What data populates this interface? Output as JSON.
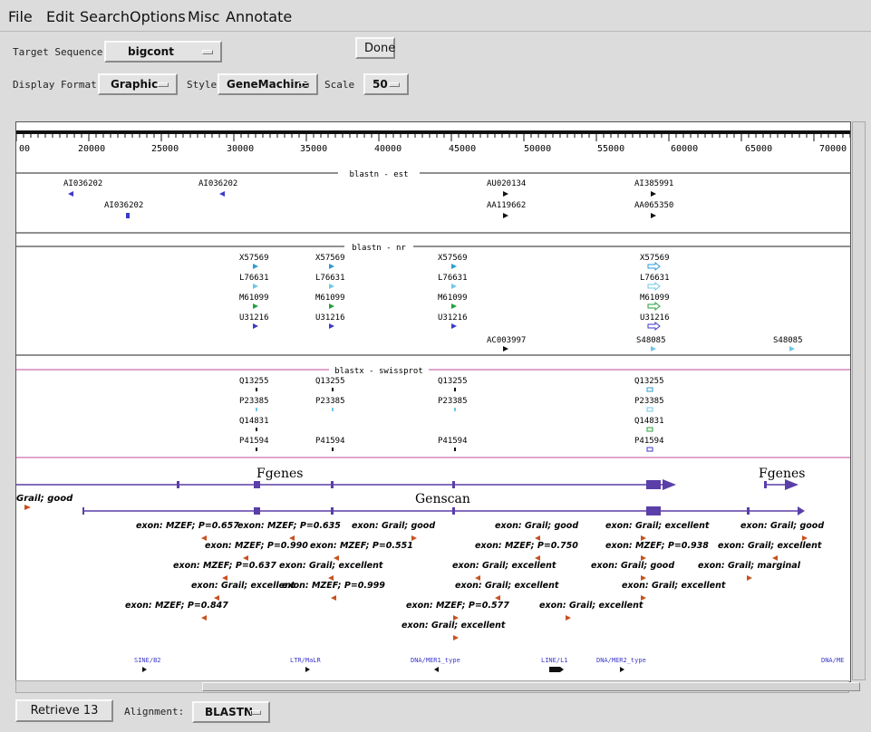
{
  "menu": {
    "items": [
      {
        "label": "File",
        "name": "menu-file"
      },
      {
        "label": "Edit",
        "name": "menu-edit"
      },
      {
        "label": "Search",
        "name": "menu-search"
      },
      {
        "label": "Options",
        "name": "menu-options"
      },
      {
        "label": "Misc",
        "name": "menu-misc"
      },
      {
        "label": "Annotate",
        "name": "menu-annotate"
      }
    ]
  },
  "controls": {
    "target_label": "Target Sequence",
    "target_value": "bigcont",
    "done_label": "Done",
    "display_format_label": "Display Format",
    "display_format_value": "Graphic",
    "style_label": "Style",
    "style_value": "GeneMachine",
    "scale_label": "Scale",
    "scale_value": "50"
  },
  "ruler": {
    "labels": [
      "00",
      "20000",
      "25000",
      "30000",
      "35000",
      "40000",
      "45000",
      "50000",
      "55000",
      "60000",
      "65000",
      "70000"
    ]
  },
  "tracks": {
    "est": {
      "title": "blastn - est",
      "hits": [
        {
          "id": "AI036202",
          "glyph": "left",
          "color": "#3b39c9"
        },
        {
          "id": "AI036202",
          "glyph": "left",
          "color": "#3b39c9"
        },
        {
          "id": "AI036202",
          "glyph": "block",
          "color": "#3b39c9"
        },
        {
          "id": "AU020134",
          "glyph": "right",
          "color": "#111111"
        },
        {
          "id": "AA119662",
          "glyph": "right",
          "color": "#111111"
        },
        {
          "id": "AI385991",
          "glyph": "right",
          "color": "#111111"
        },
        {
          "id": "AA065350",
          "glyph": "right",
          "color": "#111111"
        }
      ]
    },
    "nr": {
      "title": "blastn - nr",
      "hits": [
        {
          "id": "X57569",
          "glyph": "right",
          "color": "#2a9bd4"
        },
        {
          "id": "X57569",
          "glyph": "right",
          "color": "#2a9bd4"
        },
        {
          "id": "X57569",
          "glyph": "right",
          "color": "#2a9bd4"
        },
        {
          "id": "X57569",
          "glyph": "hollow",
          "color": "#2a9bd4"
        },
        {
          "id": "L76631",
          "glyph": "right",
          "color": "#6fc7e8"
        },
        {
          "id": "L76631",
          "glyph": "right",
          "color": "#6fc7e8"
        },
        {
          "id": "L76631",
          "glyph": "right",
          "color": "#6fc7e8"
        },
        {
          "id": "L76631",
          "glyph": "hollow",
          "color": "#6fc7e8"
        },
        {
          "id": "M61099",
          "glyph": "right",
          "color": "#22a03a"
        },
        {
          "id": "M61099",
          "glyph": "right",
          "color": "#22a03a"
        },
        {
          "id": "M61099",
          "glyph": "right",
          "color": "#22a03a"
        },
        {
          "id": "M61099",
          "glyph": "hollow",
          "color": "#22a03a"
        },
        {
          "id": "U31216",
          "glyph": "right",
          "color": "#3b39c9"
        },
        {
          "id": "U31216",
          "glyph": "right",
          "color": "#3b39c9"
        },
        {
          "id": "U31216",
          "glyph": "right",
          "color": "#3b39c9"
        },
        {
          "id": "U31216",
          "glyph": "hollow",
          "color": "#3b39c9"
        },
        {
          "id": "AC003997",
          "glyph": "right",
          "color": "#111111"
        },
        {
          "id": "S48085",
          "glyph": "right",
          "color": "#6fc7e8"
        },
        {
          "id": "S48085",
          "glyph": "right",
          "color": "#6fc7e8"
        }
      ]
    },
    "swissprot": {
      "title": "blastx - swissprot",
      "hits": [
        {
          "id": "Q13255",
          "color": "#111111"
        },
        {
          "id": "Q13255",
          "color": "#111111"
        },
        {
          "id": "Q13255",
          "color": "#111111"
        },
        {
          "id": "Q13255",
          "color": "#2a9bd4"
        },
        {
          "id": "P23385",
          "color": "#6fc7e8"
        },
        {
          "id": "P23385",
          "color": "#6fc7e8"
        },
        {
          "id": "P23385",
          "color": "#6fc7e8"
        },
        {
          "id": "P23385",
          "color": "#6fc7e8"
        },
        {
          "id": "Q14831",
          "color": "#111111"
        },
        {
          "id": "Q14831",
          "color": "#22a03a"
        },
        {
          "id": "P41594",
          "color": "#111111"
        },
        {
          "id": "P41594",
          "color": "#111111"
        },
        {
          "id": "P41594",
          "color": "#111111"
        },
        {
          "id": "P41594",
          "color": "#3b39c9"
        }
      ]
    },
    "genes": {
      "fgenes_label": "Fgenes",
      "genscan_label": "Genscan",
      "grail_label": "Grail; good",
      "gene_color": "#5a3fa8"
    },
    "exons": [
      "exon: MZEF; P=0.657",
      "exon: MZEF; P=0.635",
      "exon: Grail; good",
      "exon: Grail; good",
      "exon: Grail; excellent",
      "exon: Grail; good",
      "exon: MZEF; P=0.990",
      "exon: MZEF; P=0.551",
      "exon: MZEF; P=0.750",
      "exon: MZEF; P=0.938",
      "exon: Grail; excellent",
      "exon: MZEF; P=0.637",
      "exon: Grail; excellent",
      "exon: Grail; excellent",
      "exon: Grail; good",
      "exon: Grail; marginal",
      "exon: Grail; excellent",
      "exon: MZEF; P=0.999",
      "exon: Grail; excellent",
      "exon: Grail; excellent",
      "exon: MZEF; P=0.847",
      "exon: MZEF; P=0.577",
      "exon: Grail; excellent",
      "exon: Grail; excellent"
    ],
    "exon_color": "#c9501e",
    "repeats": [
      "SINE/B2",
      "LTR/MaLR",
      "DNA/MER1_type",
      "LINE/L1",
      "DNA/MER2_type",
      "DNA/ME"
    ]
  },
  "footer": {
    "retrieve_label": "Retrieve 13",
    "alignment_label": "Alignment:",
    "alignment_value": "BLASTN"
  }
}
